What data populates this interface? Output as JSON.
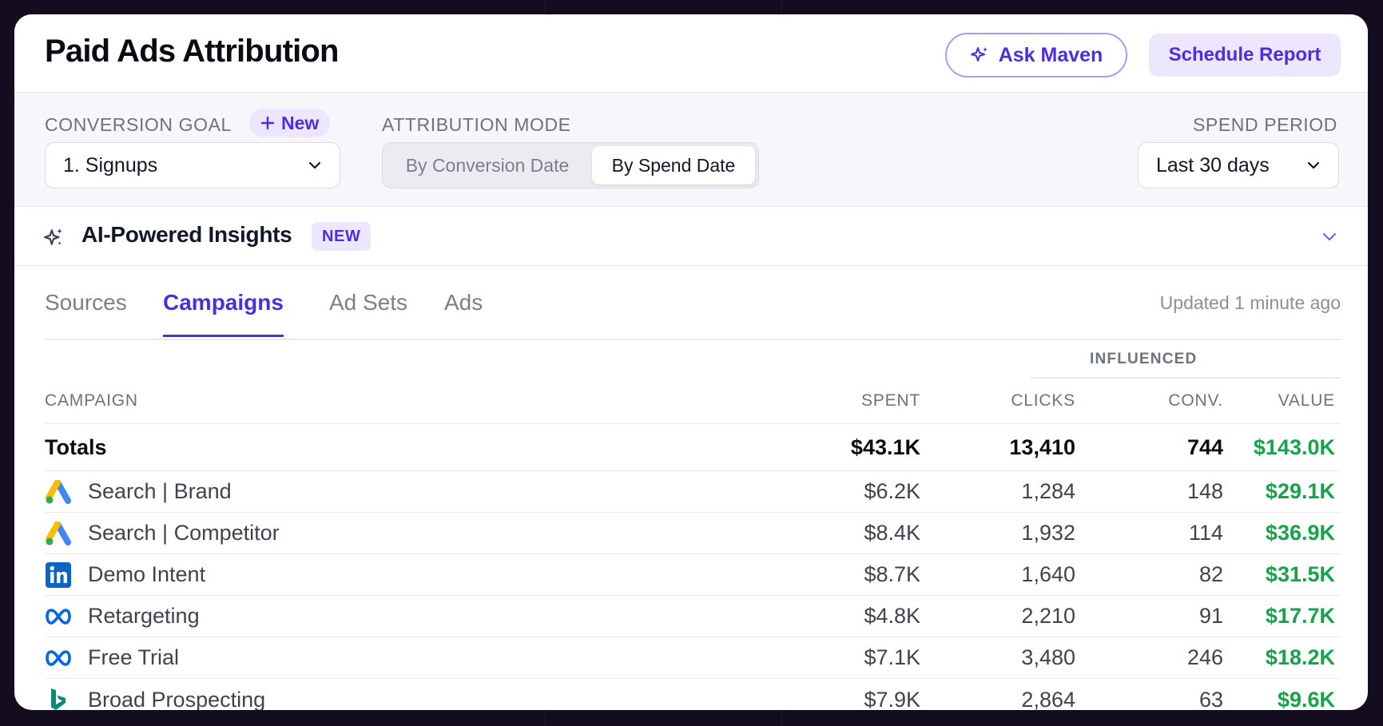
{
  "header": {
    "title": "Paid Ads Attribution",
    "ask_label": "Ask Maven",
    "schedule_label": "Schedule Report"
  },
  "controls": {
    "conversion_goal": {
      "label": "CONVERSION GOAL",
      "new_label": "New",
      "value": "1. Signups"
    },
    "attribution_mode": {
      "label": "ATTRIBUTION MODE",
      "options": [
        "By Conversion Date",
        "By Spend Date"
      ],
      "selected": "By Spend Date"
    },
    "spend_period": {
      "label": "SPEND PERIOD",
      "value": "Last 30 days"
    }
  },
  "insights": {
    "title": "AI-Powered Insights",
    "badge": "NEW"
  },
  "tabs": [
    "Sources",
    "Campaigns",
    "Ad Sets",
    "Ads"
  ],
  "active_tab": "Campaigns",
  "updated": "Updated 1 minute ago",
  "table": {
    "group_label": "INFLUENCED",
    "columns": [
      "CAMPAIGN",
      "SPENT",
      "CLICKS",
      "CONV.",
      "VALUE"
    ],
    "totals": {
      "name": "Totals",
      "spent": "$43.1K",
      "clicks": "13,410",
      "conv": "744",
      "value": "$143.0K"
    },
    "rows": [
      {
        "icon": "google-ads-icon",
        "name": "Search | Brand",
        "spent": "$6.2K",
        "clicks": "1,284",
        "conv": "148",
        "value": "$29.1K"
      },
      {
        "icon": "google-ads-icon",
        "name": "Search | Competitor",
        "spent": "$8.4K",
        "clicks": "1,932",
        "conv": "114",
        "value": "$36.9K"
      },
      {
        "icon": "linkedin-icon",
        "name": "Demo Intent",
        "spent": "$8.7K",
        "clicks": "1,640",
        "conv": "82",
        "value": "$31.5K"
      },
      {
        "icon": "meta-icon",
        "name": "Retargeting",
        "spent": "$4.8K",
        "clicks": "2,210",
        "conv": "91",
        "value": "$17.7K"
      },
      {
        "icon": "meta-icon",
        "name": "Free Trial",
        "spent": "$7.1K",
        "clicks": "3,480",
        "conv": "246",
        "value": "$18.2K"
      },
      {
        "icon": "bing-icon",
        "name": "Broad Prospecting",
        "spent": "$7.9K",
        "clicks": "2,864",
        "conv": "63",
        "value": "$9.6K"
      }
    ]
  },
  "colors": {
    "accent": "#4b2ee0",
    "value_green": "#16a34a",
    "background": "#140d1f"
  }
}
